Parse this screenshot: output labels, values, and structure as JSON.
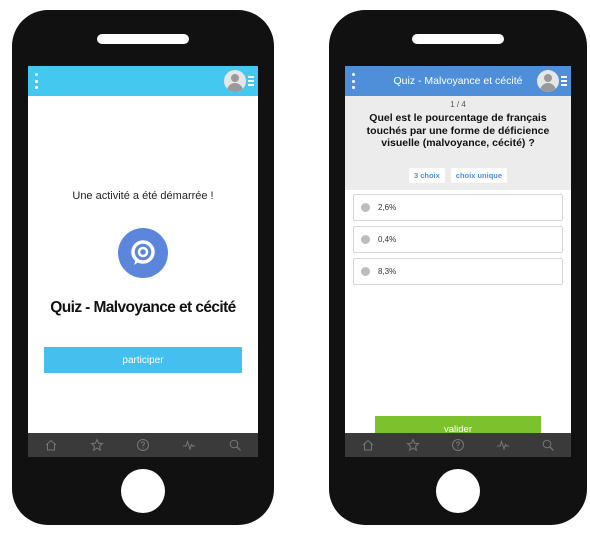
{
  "left_screen": {
    "started_text": "Une activité a été démarrée !",
    "quiz_title": "Quiz - Malvoyance et cécité",
    "participate_label": "participer"
  },
  "right_screen": {
    "topbar_title": "Quiz - Malvoyance et cécité",
    "counter": "1 / 4",
    "question": "Quel est le pourcentage de français touchés par une forme de déficience visuelle (malvoyance, cécité) ?",
    "tags": [
      "3 choix",
      "choix unique"
    ],
    "options": [
      "2,6%",
      "0,4%",
      "8,3%"
    ],
    "validate_label": "valider"
  },
  "bottom_nav": {
    "icons": [
      "home-icon",
      "star-icon",
      "help-icon",
      "activity-icon",
      "search-icon"
    ]
  },
  "colors": {
    "left_topbar": "#45c8ef",
    "right_topbar": "#4f8fd9",
    "participate_button": "#45c0ee",
    "validate_button": "#7cc22c",
    "quiz_logo": "#5b86dc"
  }
}
